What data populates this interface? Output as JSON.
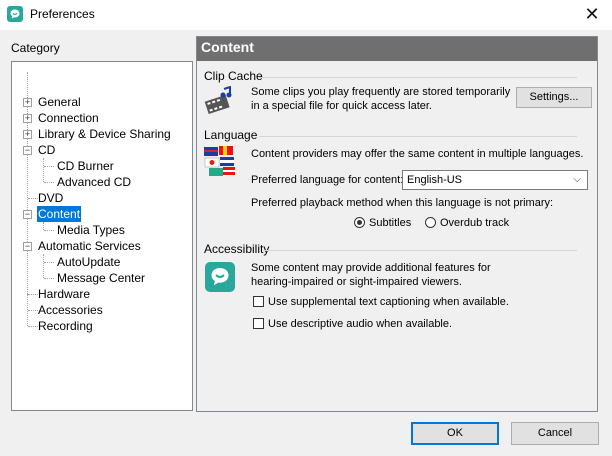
{
  "window": {
    "title": "Preferences",
    "close_glyph": "✕",
    "icon": "speech-bubble-icon"
  },
  "sidebar": {
    "label": "Category",
    "items": [
      {
        "label": "General",
        "expander": "+"
      },
      {
        "label": "Connection",
        "expander": "+"
      },
      {
        "label": "Library & Device Sharing",
        "expander": "+"
      },
      {
        "label": "CD",
        "expander": "−"
      },
      {
        "label": "CD Burner"
      },
      {
        "label": "Advanced CD"
      },
      {
        "label": "DVD"
      },
      {
        "label": "Content",
        "expander": "−",
        "selected": true
      },
      {
        "label": "Media Types"
      },
      {
        "label": "Automatic Services",
        "expander": "−"
      },
      {
        "label": "AutoUpdate"
      },
      {
        "label": "Message Center"
      },
      {
        "label": "Hardware"
      },
      {
        "label": "Accessories"
      },
      {
        "label": "Recording"
      }
    ]
  },
  "panel": {
    "title": "Content",
    "clip_cache": {
      "heading": "Clip Cache",
      "description_line1": "Some clips you play frequently are stored temporarily",
      "description_line2": "in a special file for quick access later.",
      "settings_button": "Settings..."
    },
    "language": {
      "heading": "Language",
      "description": "Content providers may offer the same content in multiple languages.",
      "preferred_label": "Preferred language for content:",
      "preferred_value": "English-US",
      "playback_label": "Preferred playback method when this language is not primary:",
      "options": [
        "Subtitles",
        "Overdub track"
      ],
      "selected_option": "Subtitles"
    },
    "accessibility": {
      "heading": "Accessibility",
      "description_line1": "Some content may provide additional features for",
      "description_line2": "hearing-impaired or sight-impaired viewers.",
      "checkbox_captioning": "Use supplemental text captioning when available.",
      "checkbox_audio": "Use descriptive audio when available.",
      "captioning_checked": false,
      "audio_checked": false
    }
  },
  "footer": {
    "ok": "OK",
    "cancel": "Cancel"
  },
  "colors": {
    "accent": "#0078d7",
    "header_bg": "#6f6f6f",
    "brand": "#2aa79b"
  }
}
